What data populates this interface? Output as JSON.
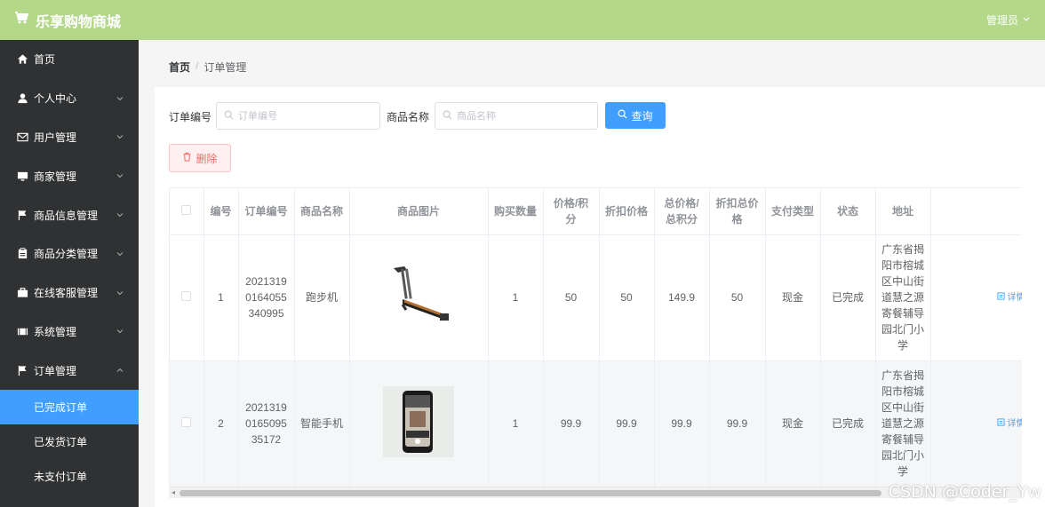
{
  "app": {
    "title": "乐享购物商城",
    "user": "管理员"
  },
  "sidebar": {
    "items": [
      {
        "label": "首页",
        "icon": "home-icon"
      },
      {
        "label": "个人中心",
        "icon": "user-icon"
      },
      {
        "label": "用户管理",
        "icon": "mail-icon"
      },
      {
        "label": "商家管理",
        "icon": "monitor-icon"
      },
      {
        "label": "商品信息管理",
        "icon": "flag-icon"
      },
      {
        "label": "商品分类管理",
        "icon": "clipboard-icon"
      },
      {
        "label": "在线客服管理",
        "icon": "briefcase-icon"
      },
      {
        "label": "系统管理",
        "icon": "film-icon"
      },
      {
        "label": "订单管理",
        "icon": "flag-icon"
      }
    ],
    "sub_items": [
      {
        "label": "已完成订单",
        "active": true
      },
      {
        "label": "已发货订单",
        "active": false
      },
      {
        "label": "未支付订单",
        "active": false
      }
    ]
  },
  "breadcrumb": {
    "home": "首页",
    "separator": "/",
    "current": "订单管理"
  },
  "search": {
    "order_label": "订单编号",
    "order_placeholder": "订单编号",
    "product_label": "商品名称",
    "product_placeholder": "商品名称",
    "query_button": "查询"
  },
  "actions": {
    "delete_button": "删除"
  },
  "table": {
    "columns": [
      "编号",
      "订单编号",
      "商品名称",
      "商品图片",
      "购买数量",
      "价格/积分",
      "折扣价格",
      "总价格/总积分",
      "折扣总价格",
      "支付类型",
      "状态",
      "地址"
    ],
    "rows": [
      {
        "index": "1",
        "order_no": "2021319016405534 0995",
        "order_no_display": "20213190164055340995",
        "product": "跑步机",
        "image": "treadmill",
        "quantity": "1",
        "price": "50",
        "discount_price": "50",
        "total": "149.9",
        "discount_total": "50",
        "pay_type": "现金",
        "status": "已完成",
        "address": "广东省揭阳市榕城区中山街道慧之源寄餐辅导园北门小学",
        "detail": "详情"
      },
      {
        "index": "2",
        "order_no": "2021319016509535172",
        "order_no_display": "2021319016509535172",
        "product": "智能手机",
        "image": "smartphone",
        "quantity": "1",
        "price": "99.9",
        "discount_price": "99.9",
        "total": "99.9",
        "discount_total": "99.9",
        "pay_type": "现金",
        "status": "已完成",
        "address": "广东省揭阳市榕城区中山街道慧之源寄餐辅导园北门小学",
        "detail": "详情"
      }
    ]
  },
  "watermark": "CSDN @Coder_Yw",
  "colors": {
    "topbar": "#b3d88a",
    "sidebar": "#2f3133",
    "active": "#409eff",
    "danger": "#f56c6c"
  }
}
